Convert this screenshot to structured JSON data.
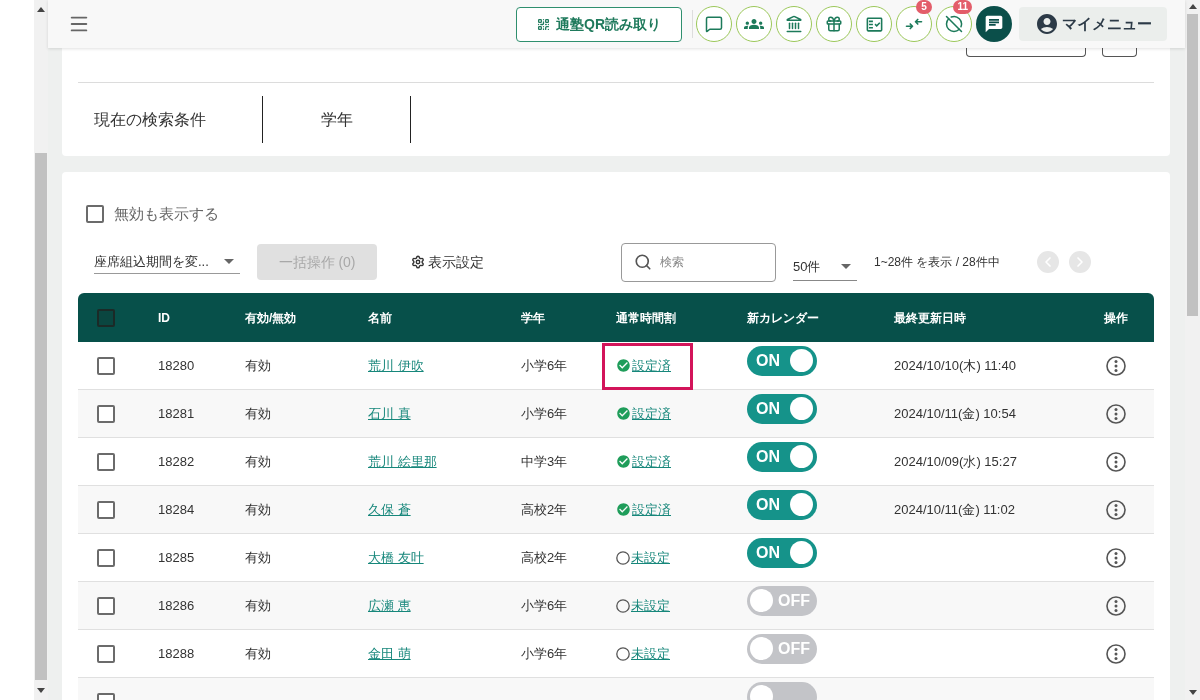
{
  "header": {
    "qr_button": {
      "label": "通塾QR読み取り"
    },
    "icon_buttons": [
      {
        "kind": "chat"
      },
      {
        "kind": "group"
      },
      {
        "kind": "bank"
      },
      {
        "kind": "gift"
      },
      {
        "kind": "checklist"
      },
      {
        "kind": "transfer",
        "badge": "5"
      },
      {
        "kind": "blocked",
        "badge": "11"
      },
      {
        "kind": "message"
      }
    ],
    "my_menu": {
      "label": "マイメニュー"
    }
  },
  "search_conditions": {
    "title": "現在の検索条件",
    "items": [
      "学年"
    ]
  },
  "filters": {
    "show_disabled": {
      "label": "無効も表示する",
      "checked": false
    },
    "period_select": {
      "value": "座席組込期間を変..."
    },
    "bulk_button": {
      "label": "一括操作 (0)",
      "disabled": true
    },
    "display_settings": {
      "label": "表示設定"
    },
    "search": {
      "placeholder": "検索"
    },
    "page_size": {
      "value": "50件"
    },
    "range_text": "1~28件 を表示 / 28件中",
    "prev_button": {
      "disabled": true
    },
    "next_button": {
      "disabled": true
    }
  },
  "table": {
    "header_checked": false,
    "columns": [
      "ID",
      "有効/無効",
      "名前",
      "学年",
      "通常時間割",
      "新カレンダー",
      "最終更新日時",
      "操作"
    ],
    "rows": [
      {
        "checked": false,
        "id": "18280",
        "status": "有効",
        "name": "荒川 伊吹",
        "grade": "小学6年",
        "schedule": {
          "set": true,
          "label": "設定済",
          "highlighted": true
        },
        "calendar": {
          "on": true,
          "label": "ON"
        },
        "updated": "2024/10/10(木) 11:40"
      },
      {
        "checked": false,
        "id": "18281",
        "status": "有効",
        "name": "石川 真",
        "grade": "小学6年",
        "schedule": {
          "set": true,
          "label": "設定済",
          "highlighted": false
        },
        "calendar": {
          "on": true,
          "label": "ON"
        },
        "updated": "2024/10/11(金) 10:54"
      },
      {
        "checked": false,
        "id": "18282",
        "status": "有効",
        "name": "荒川 絵里那",
        "grade": "中学3年",
        "schedule": {
          "set": true,
          "label": "設定済",
          "highlighted": false
        },
        "calendar": {
          "on": true,
          "label": "ON"
        },
        "updated": "2024/10/09(水) 15:27"
      },
      {
        "checked": false,
        "id": "18284",
        "status": "有効",
        "name": "久保 蒼",
        "grade": "高校2年",
        "schedule": {
          "set": true,
          "label": "設定済",
          "highlighted": false
        },
        "calendar": {
          "on": true,
          "label": "ON"
        },
        "updated": "2024/10/11(金) 11:02"
      },
      {
        "checked": false,
        "id": "18285",
        "status": "有効",
        "name": "大橋 友叶",
        "grade": "高校2年",
        "schedule": {
          "set": false,
          "label": "未設定",
          "highlighted": false
        },
        "calendar": {
          "on": true,
          "label": "ON"
        }
      },
      {
        "checked": false,
        "id": "18286",
        "status": "有効",
        "name": "広瀬 恵",
        "grade": "小学6年",
        "schedule": {
          "set": false,
          "label": "未設定",
          "highlighted": false
        },
        "calendar": {
          "on": false,
          "label": "OFF"
        }
      },
      {
        "checked": false,
        "id": "18288",
        "status": "有効",
        "name": "金田 萌",
        "grade": "小学6年",
        "schedule": {
          "set": false,
          "label": "未設定",
          "highlighted": false
        },
        "calendar": {
          "on": false,
          "label": "OFF"
        }
      },
      {
        "checked": false,
        "calendar": {
          "on": false
        }
      }
    ]
  }
}
